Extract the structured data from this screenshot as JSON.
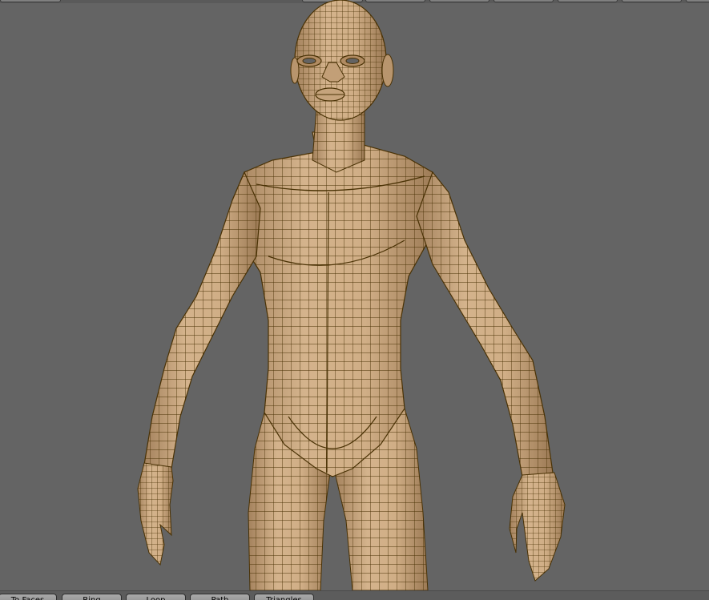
{
  "colors": {
    "viewport_background": "#646464",
    "mesh_fill": "#c9a67f",
    "mesh_wire": "#4a3205"
  },
  "toolbar": {
    "buttons": [
      {
        "name": "to-faces-button",
        "label": "To Faces"
      },
      {
        "name": "ring-button",
        "label": "Ring"
      },
      {
        "name": "loop-button",
        "label": "Loop"
      },
      {
        "name": "path-button",
        "label": "Path"
      },
      {
        "name": "triangles-button",
        "label": "Triangles"
      }
    ]
  }
}
